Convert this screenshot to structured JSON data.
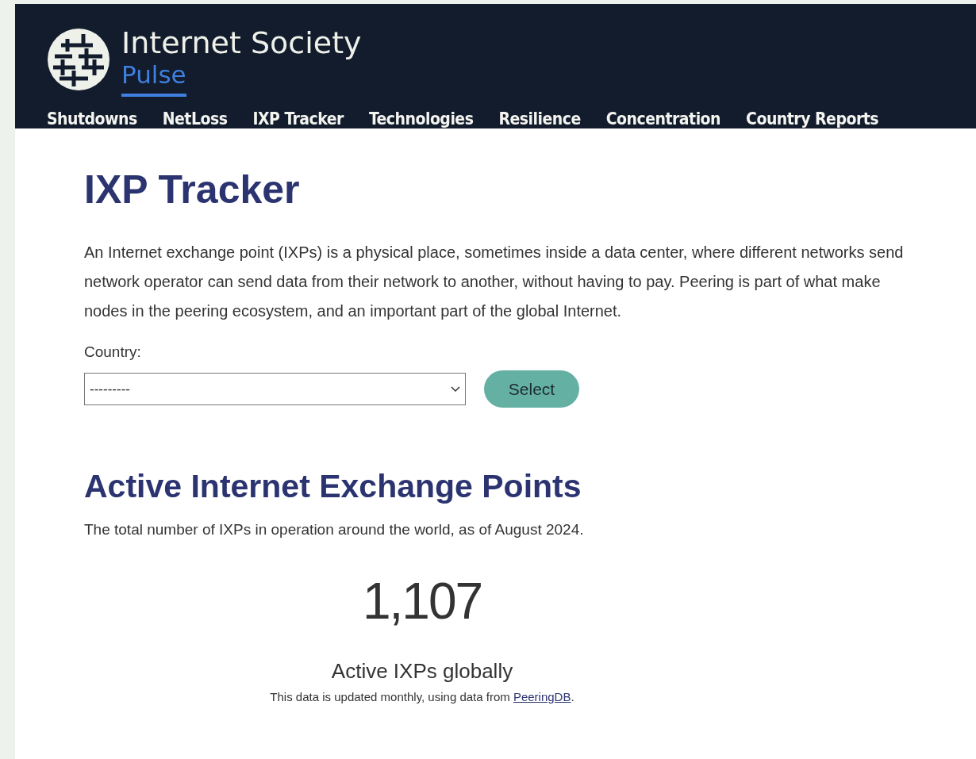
{
  "header": {
    "brand": "Internet Society",
    "sub_brand": "Pulse"
  },
  "nav": [
    {
      "label": "Shutdowns"
    },
    {
      "label": "NetLoss"
    },
    {
      "label": "IXP Tracker"
    },
    {
      "label": "Technologies"
    },
    {
      "label": "Resilience"
    },
    {
      "label": "Concentration"
    },
    {
      "label": "Country Reports"
    }
  ],
  "page_title": "IXP Tracker",
  "intro_lines": [
    "An Internet exchange point (IXPs) is a physical place, sometimes inside a data center, where different networks send",
    "network operator can send data from their network to another, without having to pay. Peering is part of what make",
    "nodes in the peering ecosystem, and an important part of the global Internet."
  ],
  "country_form": {
    "label": "Country:",
    "value": "---------",
    "button": "Select"
  },
  "section": {
    "title": "Active Internet Exchange Points",
    "description": "The total number of IXPs in operation around the world, as of August 2024.",
    "count": "1,107",
    "count_label": "Active IXPs globally",
    "note": "This data is updated monthly, using data from",
    "note_link": "PeeringDB",
    "note_end": "."
  }
}
